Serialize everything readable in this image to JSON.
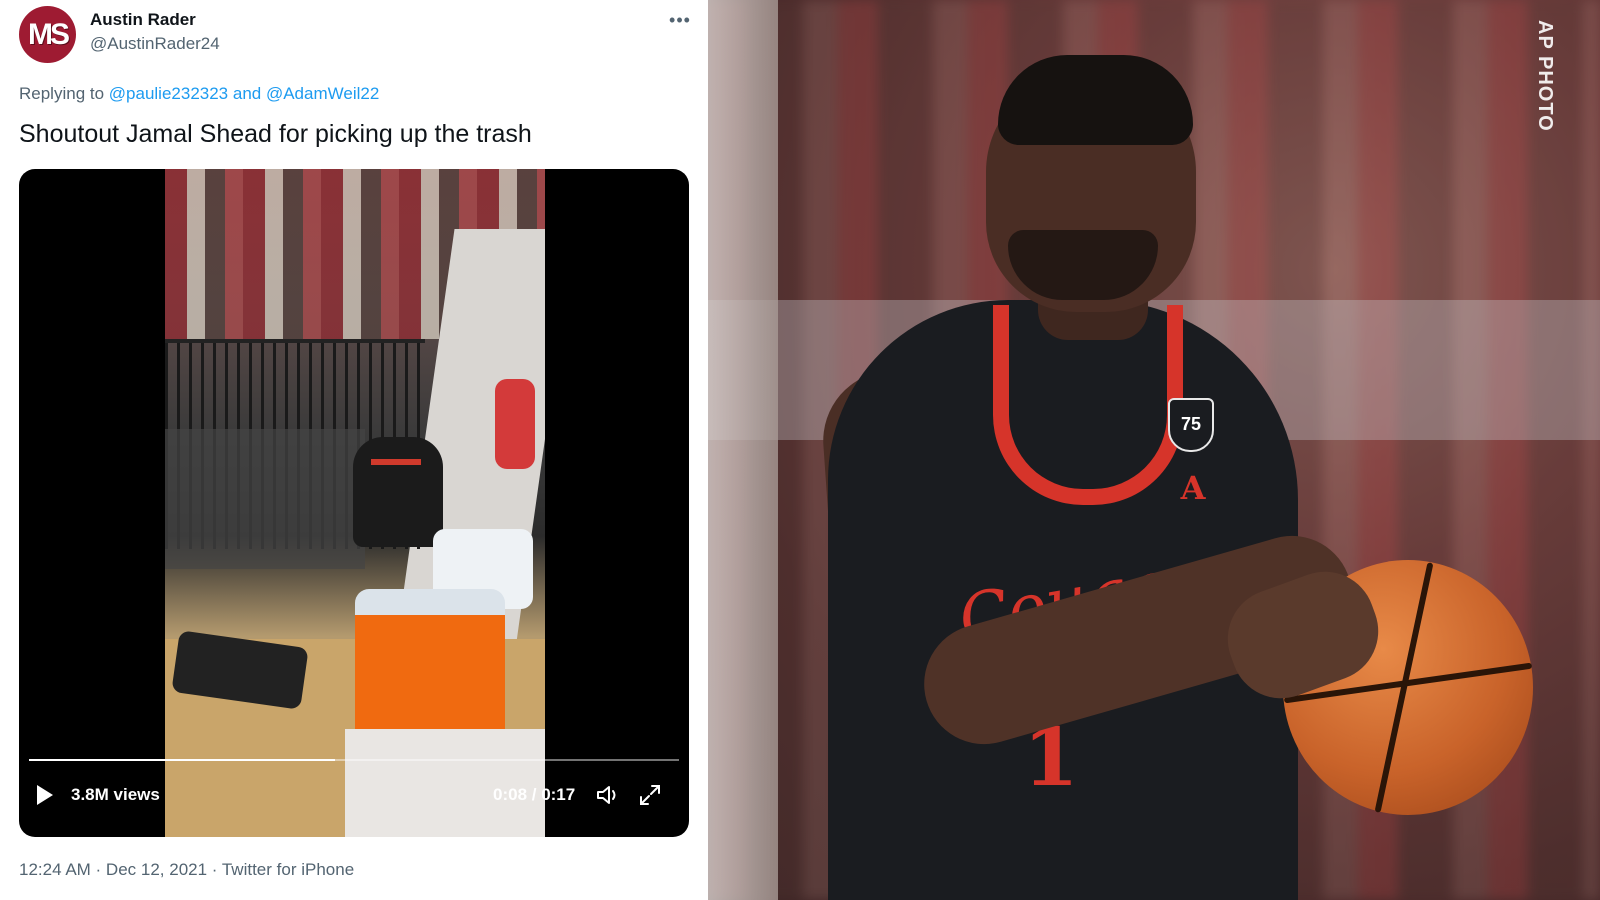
{
  "tweet": {
    "avatar_text": "MS",
    "author_name": "Austin Rader",
    "author_handle": "@AustinRader24",
    "more_icon": "ellipsis-icon",
    "reply_prefix": "Replying to ",
    "reply_mention_1": "@paulie232323",
    "reply_and": " and ",
    "reply_mention_2": "@AdamWeil22",
    "text": "Shoutout Jamal Shead for picking up the trash",
    "video": {
      "views": "3.8M views",
      "time": "0:08 / 0:17",
      "progress": 0.47,
      "icons": [
        "play-icon",
        "volume-icon",
        "fullscreen-icon"
      ]
    },
    "meta": "12:24 AM · Dec 12, 2021 · Twitter for iPhone"
  },
  "photo": {
    "credit": "AP PHOTO",
    "jersey_script": "Cougars",
    "jersey_number": "1",
    "patch_text": "75",
    "conference_logo": "A"
  },
  "colors": {
    "link": "#1d9bf0",
    "secondary_text": "#536471",
    "primary_text": "#0f1419",
    "jersey_red": "#d6342a"
  }
}
